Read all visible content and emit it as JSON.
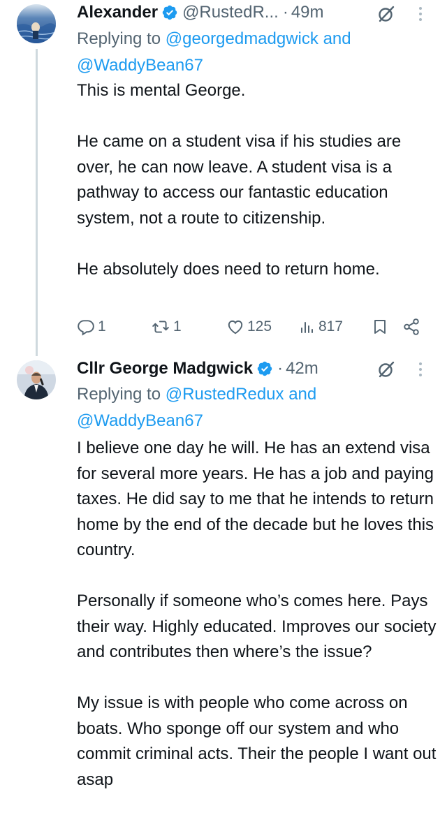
{
  "tweets": [
    {
      "display_name": "Alexander",
      "handle": "@RustedR...",
      "separator": "·",
      "time": "49m",
      "replying_prefix": "Replying to",
      "reply_mention_1": "@georgedmadgwick",
      "reply_and": "and",
      "reply_mention_2": "@WaddyBean67",
      "paragraphs": [
        "This is mental George.",
        "He came on a student visa if his studies are over, he can now leave. A student visa is a pathway to access our fantastic education system, not a route to citizenship.",
        "He absolutely does need to return home."
      ],
      "stats": {
        "replies": "1",
        "reposts": "1",
        "likes": "125",
        "views": "817"
      }
    },
    {
      "display_name": "Cllr George Madgwick",
      "separator": "·",
      "time": "42m",
      "replying_prefix": "Replying to",
      "reply_mention_1": "@RustedRedux",
      "reply_and": "and",
      "reply_mention_2": "@WaddyBean67",
      "paragraphs": [
        "I believe one day he will. He has an extend visa for several more years. He has a job and paying taxes. He did say to me that he intends to return home by the end of the decade but he loves this country.",
        "Personally if someone who’s comes here. Pays their way. Highly educated. Improves our society and contributes then where’s the issue?",
        "My issue is with people who come across on boats. Who sponge off our system and who commit criminal acts. Their the people I want out asap"
      ]
    }
  ],
  "colors": {
    "text": "#0f1419",
    "secondary": "#536471",
    "link": "#1d9bf0",
    "verified": "#1d9bf0",
    "thread_line": "#cfd9de"
  },
  "icons": [
    "verified-badge-icon",
    "grok-icon",
    "more-icon",
    "reply-icon",
    "repost-icon",
    "like-icon",
    "views-icon",
    "bookmark-icon",
    "share-icon"
  ]
}
